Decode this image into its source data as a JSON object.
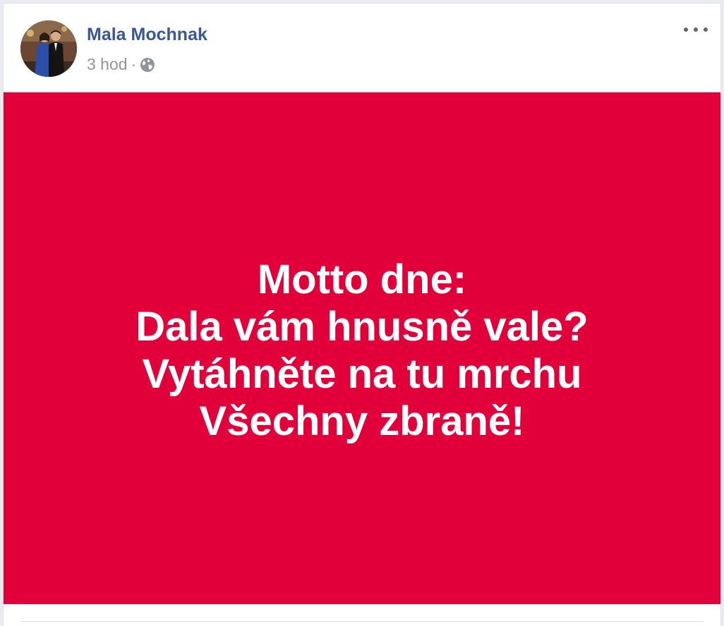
{
  "post": {
    "author": "Mala Mochnak",
    "time": "3 hod",
    "separator": "·",
    "privacy_icon": "globe-icon",
    "more_icon": "more-options-icon",
    "avatar": "profile-photo",
    "background_color": "#e2003a",
    "text_lines": [
      "Motto dne:",
      "Dala vám hnusně vale?",
      "Vytáhněte na tu mrchu",
      "Všechny zbraně!"
    ]
  },
  "colors": {
    "author_link": "#385898",
    "meta_text": "#90949c",
    "post_background": "#e2003a",
    "post_text": "#ffffff"
  }
}
